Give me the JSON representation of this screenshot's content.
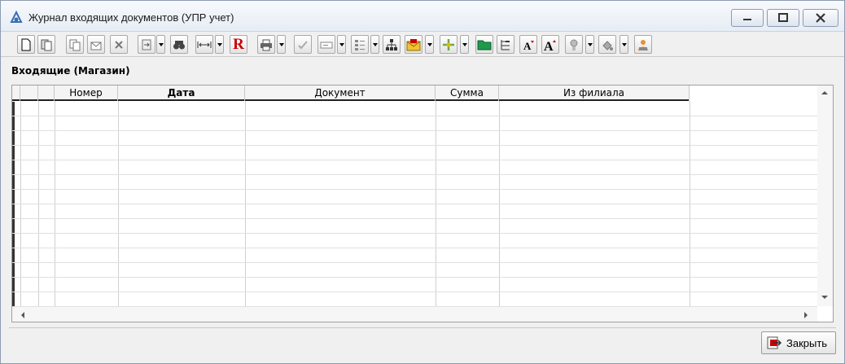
{
  "window": {
    "title": "Журнал входящих документов (УПР учет)",
    "controls": [
      "minimize",
      "maximize",
      "close"
    ]
  },
  "toolbar": {
    "buttons": [
      "new-document-icon",
      "copy-record-icon",
      "copy-icon",
      "envelope-icon",
      "delete-icon",
      "import-icon",
      "binoculars-icon",
      "fit-columns-icon",
      "report-r-icon",
      "print-icon",
      "checkmark-icon",
      "form-icon",
      "list-options-icon",
      "tree-icon",
      "mail-open-icon",
      "refresh-icon",
      "folder-icon",
      "grouping-icon",
      "font-decrease-icon",
      "font-increase-icon",
      "settings-icon",
      "paint-icon",
      "user-icon"
    ],
    "report_letter": "R"
  },
  "section": {
    "title": "Входящие (Магазин)"
  },
  "table": {
    "columns": [
      "Номер",
      "Дата",
      "Документ",
      "Сумма",
      "Из филиала"
    ],
    "sorted_column": "Дата",
    "rows": []
  },
  "footer": {
    "close_label": "Закрыть"
  },
  "colors": {
    "title_bg": "#eef2f8",
    "report_red": "#cc0000",
    "folder_green": "#1e9a4a"
  }
}
